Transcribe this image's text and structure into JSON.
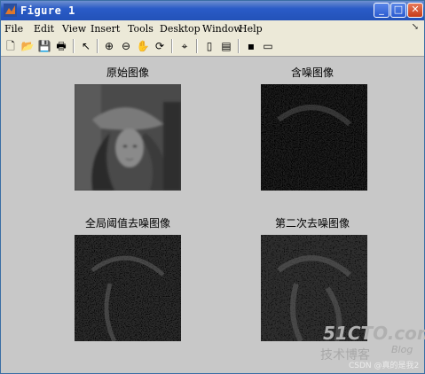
{
  "window": {
    "title": "Figure 1"
  },
  "menu": [
    "File",
    "Edit",
    "View",
    "Insert",
    "Tools",
    "Desktop",
    "Window",
    "Help"
  ],
  "menu_arrow": "↘",
  "toolbar_icons": [
    "new-figure-icon",
    "open-icon",
    "save-icon",
    "print-icon",
    "pointer-icon",
    "zoom-in-icon",
    "zoom-out-icon",
    "pan-icon",
    "rotate-icon",
    "data-cursor-icon",
    "colorbar-icon",
    "legend-icon",
    "hide-plot-tools-icon",
    "show-plot-tools-icon"
  ],
  "panels": [
    {
      "title": "原始图像",
      "kind": "original"
    },
    {
      "title": "含噪图像",
      "kind": "noisy"
    },
    {
      "title": "全局阈值去噪图像",
      "kind": "global"
    },
    {
      "title": "第二次去噪图像",
      "kind": "second"
    }
  ],
  "watermark": {
    "brand": "51CTO.com",
    "sub": "技术博客",
    "blog": "Blog",
    "credit": "CSDN @真的是我2"
  }
}
